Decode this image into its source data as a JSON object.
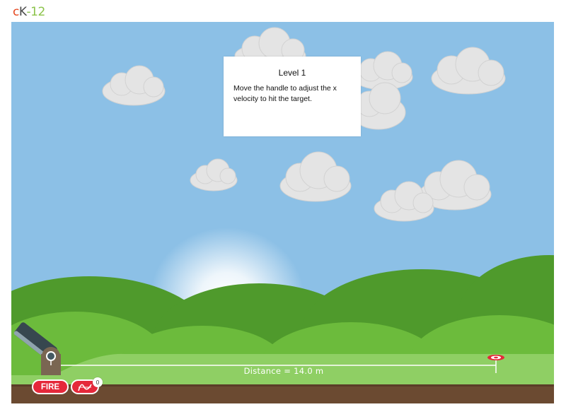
{
  "logo": {
    "c": "c",
    "k": "K",
    "dash": "-",
    "num": "12"
  },
  "dialog": {
    "title": "Level 1",
    "message": "Move the handle to adjust the x velocity to hit the target."
  },
  "distance_label": "Distance = 14.0 m",
  "controls": {
    "fire_label": "FIRE",
    "trace_count": "0"
  },
  "colors": {
    "sky": "#8cc0e6",
    "hill_dark": "#4f9a2c",
    "hill_light": "#6cbb3c",
    "field": "#8fcf64",
    "ground": "#6b4a31",
    "accent_red": "#e5283a"
  },
  "icons": [
    "cannon-icon",
    "target-icon",
    "trajectory-icon"
  ]
}
